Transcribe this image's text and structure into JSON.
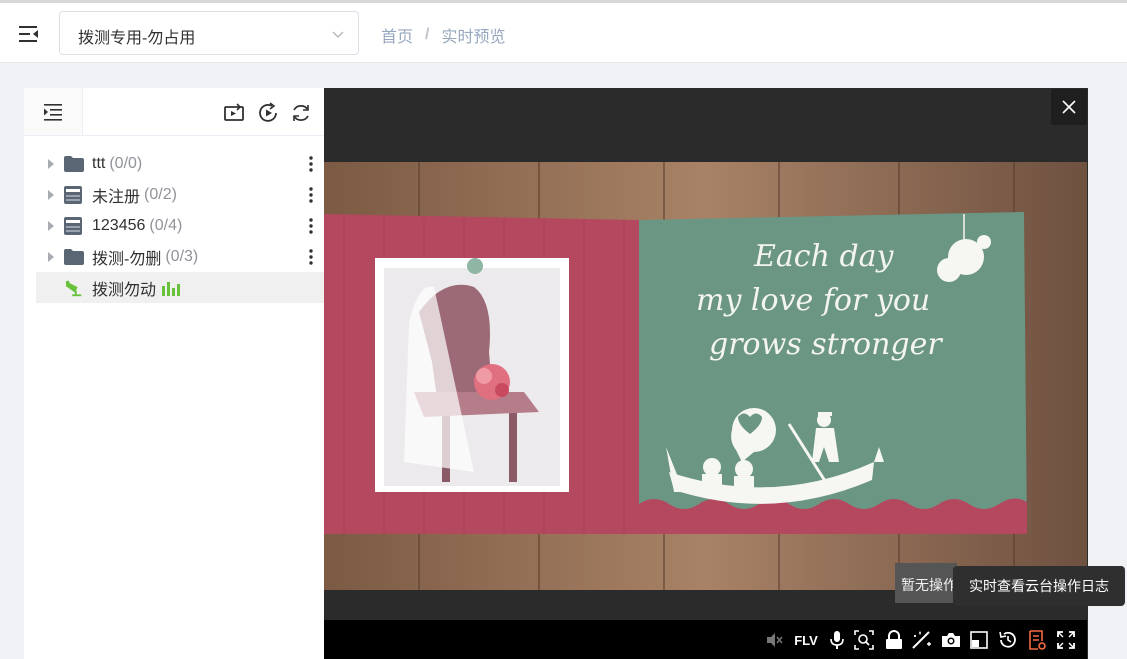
{
  "header": {
    "org_select_value": "拨测专用-勿占用",
    "breadcrumb": [
      "首页",
      "实时预览"
    ]
  },
  "tree": {
    "nodes": [
      {
        "label": "ttt",
        "count": "(0/0)",
        "icon": "folder-icon"
      },
      {
        "label": "未注册",
        "count": "(0/2)",
        "icon": "nvr-icon"
      },
      {
        "label": "123456",
        "count": "(0/4)",
        "icon": "nvr-icon"
      },
      {
        "label": "拨测-勿删",
        "count": "(0/3)",
        "icon": "folder-icon"
      },
      {
        "label": "拨测勿动",
        "icon": "camera-icon",
        "active": true
      }
    ]
  },
  "video": {
    "overlay_text_lines": [
      "Each day",
      "my love for you",
      "grows stronger"
    ]
  },
  "player": {
    "ptz_status": "暂无操作",
    "tooltip": "实时查看云台操作日志",
    "stream_format": "FLV",
    "controls": [
      "mute-icon",
      "flv-label",
      "microphone-icon",
      "zoom-icon",
      "lock-icon",
      "wand-icon",
      "snapshot-icon",
      "window-icon",
      "history-icon",
      "ptz-log-icon",
      "fullscreen-icon"
    ]
  },
  "colors": {
    "accent": "#67c23a",
    "ptz_log_active": "#f56c42",
    "tree_icon": "#5a6673"
  }
}
